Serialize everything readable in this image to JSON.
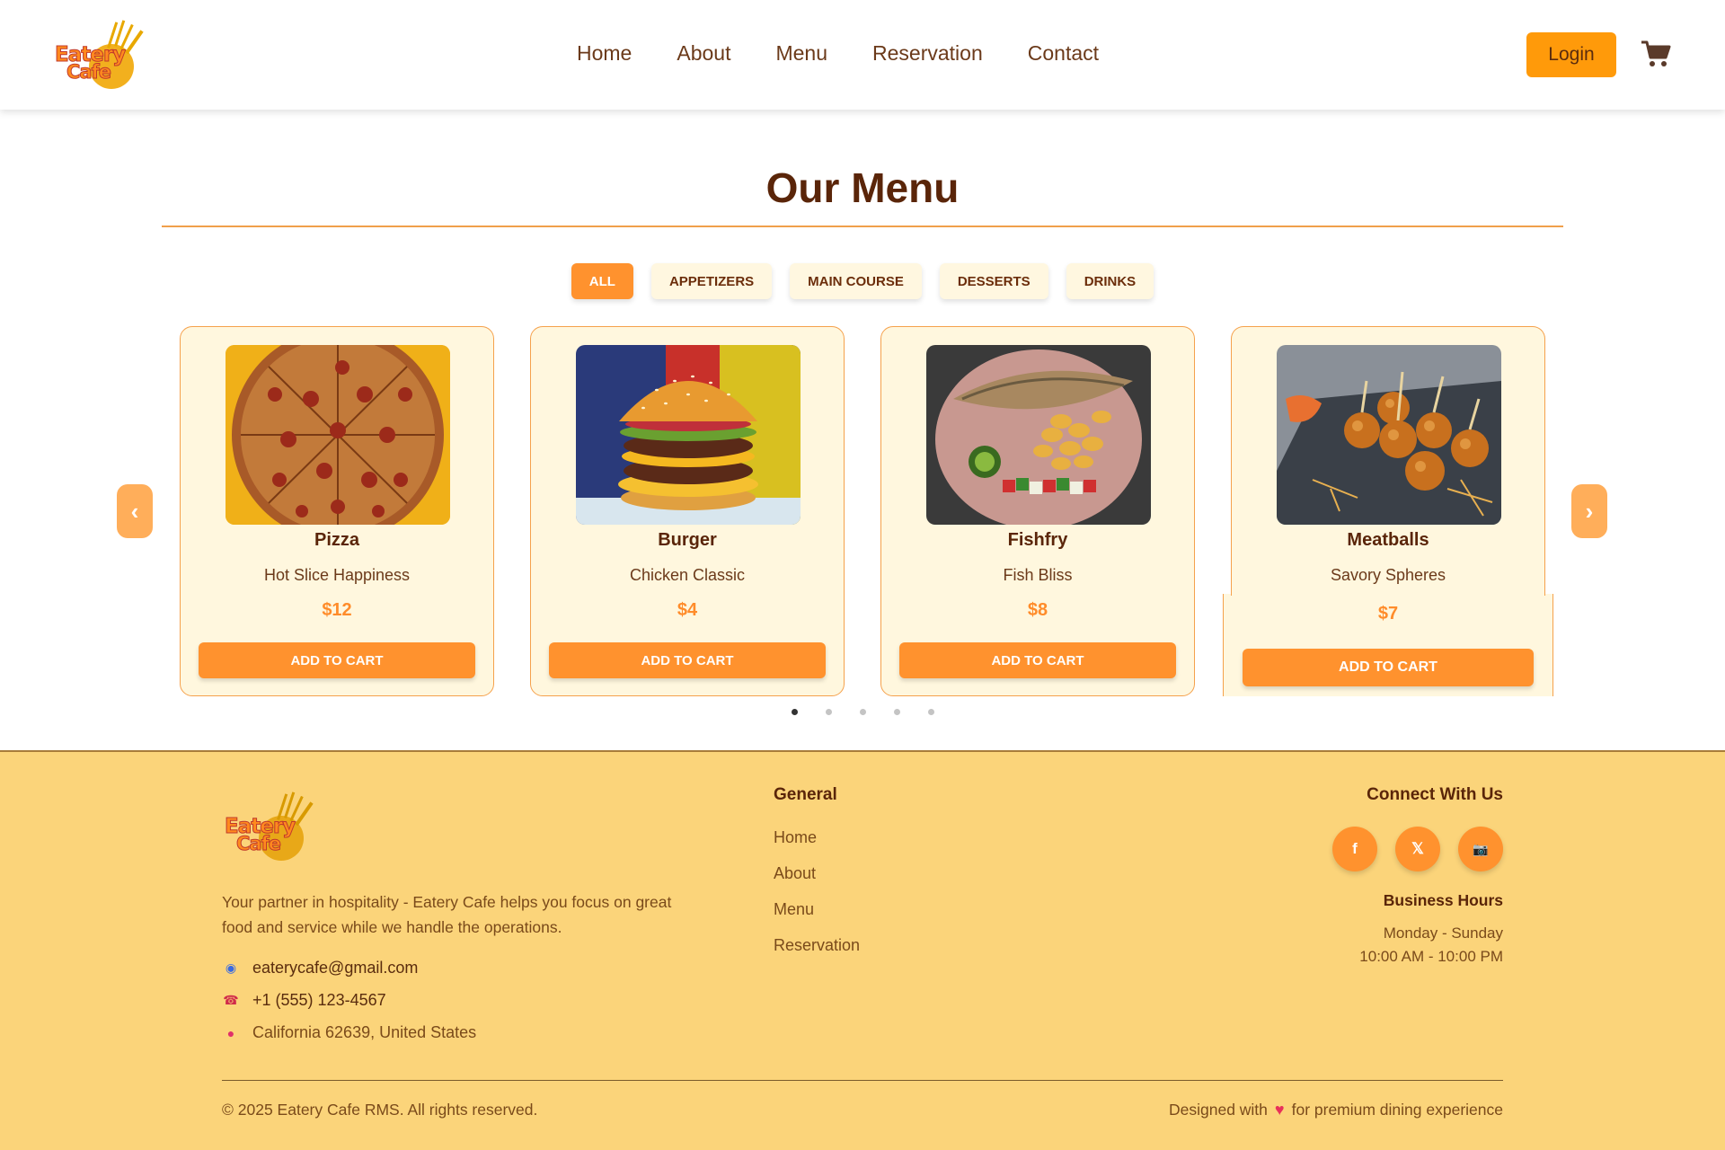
{
  "header": {
    "logo": {
      "line1": "Eatery",
      "line2": "Cafe"
    },
    "nav": [
      "Home",
      "About",
      "Menu",
      "Reservation",
      "Contact"
    ],
    "login_label": "Login",
    "cart_icon": "shopping-cart-icon"
  },
  "menu": {
    "title": "Our Menu",
    "filters": [
      "ALL",
      "APPETIZERS",
      "MAIN COURSE",
      "DESSERTS",
      "DRINKS"
    ],
    "active_filter": "ALL",
    "prev_arrow": "‹",
    "next_arrow": "›",
    "items": [
      {
        "name": "Pizza",
        "desc": "Hot Slice Happiness",
        "price": "$12",
        "button": "ADD TO CART",
        "image": "pizza"
      },
      {
        "name": "Burger",
        "desc": "Chicken Classic",
        "price": "$4",
        "button": "ADD TO CART",
        "image": "burger"
      },
      {
        "name": "Fishfry",
        "desc": "Fish Bliss",
        "price": "$8",
        "button": "ADD TO CART",
        "image": "fish"
      },
      {
        "name": "Meatballs",
        "desc": "Savory Spheres",
        "price": "$7",
        "button": "ADD TO CART",
        "image": "meatballs"
      }
    ],
    "pagination": {
      "count": 5,
      "active": 1
    }
  },
  "footer": {
    "description": "Your partner in hospitality - Eatery Cafe helps you focus on great food and service while we handle the operations.",
    "contacts": [
      {
        "icon": "email-icon",
        "text": "eaterycafe@gmail.com"
      },
      {
        "icon": "phone-icon",
        "text": "+1 (555) 123-4567"
      },
      {
        "icon": "location-pin-icon",
        "text": "California 62639, United States"
      }
    ],
    "general_heading": "General",
    "general_links": [
      "Home",
      "About",
      "Menu",
      "Reservation"
    ],
    "connect_heading": "Connect With Us",
    "social": [
      {
        "icon": "facebook-icon",
        "glyph": "f"
      },
      {
        "icon": "x-twitter-icon",
        "glyph": "𝕏"
      },
      {
        "icon": "instagram-icon",
        "glyph": "📷"
      }
    ],
    "hours_heading": "Business Hours",
    "hours_days": "Monday - Sunday",
    "hours_time": "10:00 AM - 10:00 PM",
    "copyright": "© 2025 Eatery Cafe RMS. All rights reserved.",
    "designed_prefix": "Designed with",
    "designed_suffix": "for premium dining experience"
  },
  "colors": {
    "accent": "#ff922e",
    "brown": "#5a2509",
    "footer_bg": "#fbd47a",
    "card_bg": "#fff7de"
  }
}
